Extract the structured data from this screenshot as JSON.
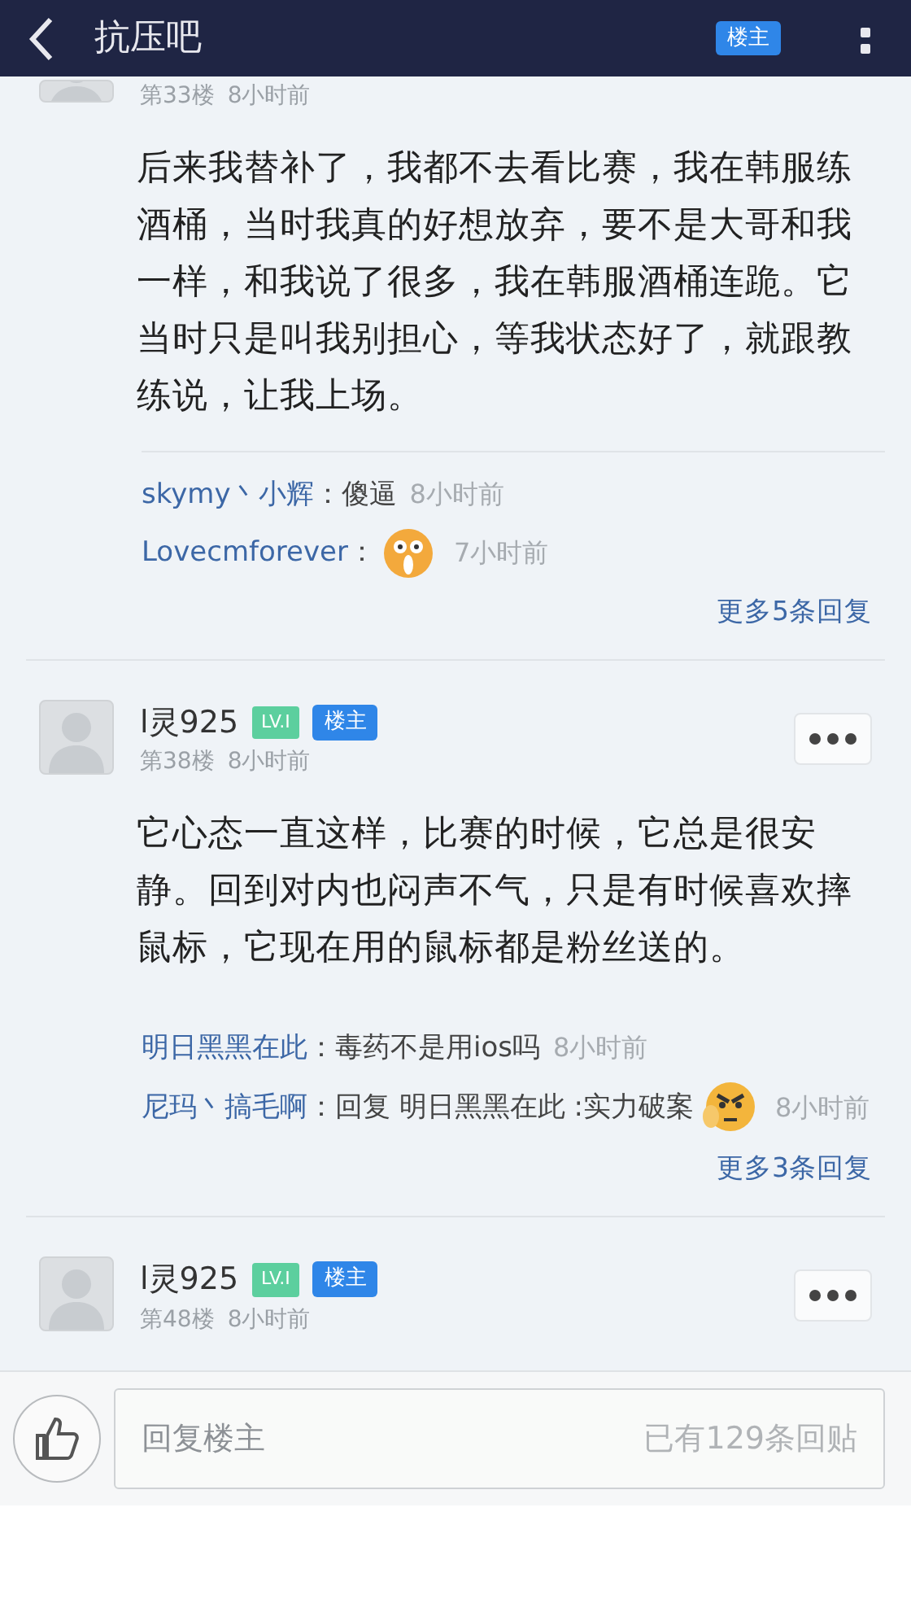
{
  "header": {
    "title": "抗压吧",
    "badge": "楼主"
  },
  "posts": [
    {
      "partial": true,
      "floor": "第33楼",
      "time": "8小时前",
      "body": "后来我替补了，我都不去看比赛，我在韩服练酒桶，当时我真的好想放弃，要不是大哥和我一样，和我说了很多，我在韩服酒桶连跪。它当时只是叫我别担心，等我状态好了，就跟教练说，让我上场。",
      "replies": [
        {
          "user": "skymy丶小辉",
          "colon": "：",
          "text": "傻逼",
          "time": "8小时前"
        },
        {
          "user": "Lovecmforever",
          "colon": "：",
          "sticker": {
            "kind": "surprised"
          },
          "time": "7小时前"
        }
      ],
      "more": "更多5条回复"
    },
    {
      "partial": false,
      "user": "l灵925",
      "level": "LV.I",
      "badge": "楼主",
      "floor": "第38楼",
      "time": "8小时前",
      "body": "它心态一直这样，比赛的时候，它总是很安静。回到对内也闷声不气，只是有时候喜欢摔鼠标，它现在用的鼠标都是粉丝送的。",
      "replies": [
        {
          "user": "明日黑黑在此",
          "colon": "：",
          "text": "毒药不是用ios吗",
          "time": "8小时前"
        },
        {
          "user": "尼玛丶搞毛啊",
          "colon": "：",
          "text": "回复 明日黑黑在此 :实力破案",
          "sticker": {
            "kind": "angry"
          },
          "time": "8小时前"
        }
      ],
      "more": "更多3条回复"
    },
    {
      "partial": false,
      "user": "l灵925",
      "level": "LV.I",
      "badge": "楼主",
      "floor": "第48楼",
      "time": "8小时前"
    }
  ],
  "footer": {
    "placeholder": "回复楼主",
    "count": "已有129条回贴"
  }
}
